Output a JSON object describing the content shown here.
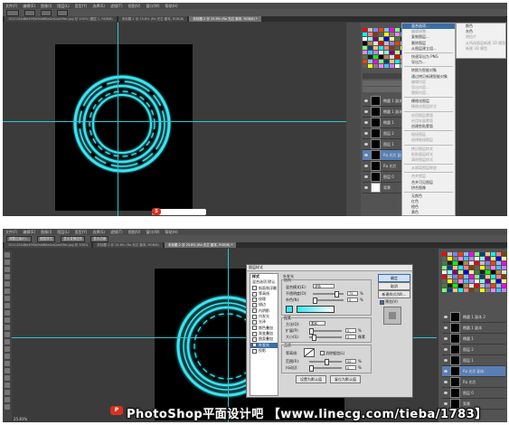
{
  "top": {
    "menubar": [
      "文件(F)",
      "编辑(E)",
      "图像(I)",
      "图层(L)",
      "类型(Y)",
      "选择(S)",
      "滤镜(T)",
      "视图(V)",
      "窗口(W)",
      "帮助(H)"
    ],
    "tabs": [
      "1511204d8e49f5b9dd68a0cb2ae0fec.jpg @ 100% (图层 1, RGB/8)",
      "未标题-1 @ 25.8% (Ra 光芯 副本, RGB/8)",
      "未标题-2 @ 25.8% (Ra 光芯 副本, RGB/8) *"
    ],
    "context_menu": [
      {
        "label": "混合选项...",
        "state": "hi"
      },
      {
        "label": "编辑调整...",
        "state": "dis"
      },
      {
        "label": "复制图层...",
        "state": "normal"
      },
      {
        "label": "删除图层",
        "state": "normal"
      },
      {
        "label": "从图层建立组...",
        "state": "normal"
      },
      {
        "sep": true
      },
      {
        "label": "快速导出为 PNG",
        "state": "normal"
      },
      {
        "label": "导出为...",
        "state": "normal"
      },
      {
        "sep": true
      },
      {
        "label": "转换为智能对象",
        "state": "normal"
      },
      {
        "label": "通过拷贝新建智能对象",
        "state": "normal"
      },
      {
        "label": "编辑内容",
        "state": "dis"
      },
      {
        "label": "导出内容...",
        "state": "dis"
      },
      {
        "label": "替换内容...",
        "state": "dis"
      },
      {
        "sep": true
      },
      {
        "label": "栅格化图层",
        "state": "normal"
      },
      {
        "label": "栅格化图层样式",
        "state": "dis"
      },
      {
        "sep": true
      },
      {
        "label": "启用图层蒙版",
        "state": "dis"
      },
      {
        "label": "启用矢量蒙版",
        "state": "dis"
      },
      {
        "label": "创建剪贴蒙版",
        "state": "normal"
      },
      {
        "sep": true
      },
      {
        "label": "链接图层",
        "state": "dis"
      },
      {
        "label": "选择链接图层",
        "state": "dis"
      },
      {
        "sep": true
      },
      {
        "label": "拷贝图层样式",
        "state": "dis"
      },
      {
        "label": "粘贴图层样式",
        "state": "dis"
      },
      {
        "label": "清除图层样式",
        "state": "dis"
      },
      {
        "sep": true
      },
      {
        "label": "从隔离图层释放",
        "state": "dis"
      },
      {
        "sep": true
      },
      {
        "label": "合并图层",
        "state": "dis"
      },
      {
        "label": "合并可见图层",
        "state": "normal"
      },
      {
        "label": "拼合图像",
        "state": "normal"
      },
      {
        "sep": true
      },
      {
        "label": "无颜色",
        "state": "normal"
      },
      {
        "label": "红色",
        "state": "normal"
      },
      {
        "label": "橙色",
        "state": "normal"
      },
      {
        "label": "黄色",
        "state": "normal"
      },
      {
        "label": "绿色",
        "state": "normal"
      }
    ],
    "submenu": [
      "颜色",
      "灰色",
      "明信片",
      "从所选图层新建 3D 模型",
      "新建 3D 模型"
    ],
    "layers": [
      {
        "name": "椭圆 1 副本 2",
        "thumb": "black"
      },
      {
        "name": "椭圆 1 副本",
        "thumb": "black"
      },
      {
        "name": "椭圆 1",
        "thumb": "black"
      },
      {
        "name": "图层 2",
        "thumb": "black"
      },
      {
        "name": "图层 1",
        "thumb": "black"
      },
      {
        "name": "Ra 光芯 副本",
        "thumb": "black",
        "selected": true
      },
      {
        "name": "Ra 光芯",
        "thumb": "black"
      },
      {
        "name": "图层 0",
        "thumb": "black"
      },
      {
        "name": "背景",
        "thumb": "white"
      }
    ]
  },
  "bottom": {
    "menubar": [
      "文件(F)",
      "编辑(E)",
      "图像(I)",
      "图层(L)",
      "类型(Y)",
      "选择(S)",
      "滤镜(T)",
      "视图(V)",
      "窗口(W)",
      "帮助(H)"
    ],
    "options": [
      "调整边缘(E)...",
      "图层样式",
      "显示变换控件",
      "显示边缘"
    ],
    "tabs": [
      "1511204d8e49f5b9dd68a0cb2ae0fec.jpg @ 100%",
      "未标题-1 @ 25.8% (Ra 光芯 副本, RGB/8)",
      "未标题-2 @ 25.8% (Ra 光芯 副本, RGB/8) *"
    ],
    "dialog": {
      "title": "图层样式",
      "style_list_header": "样式",
      "style_list": [
        {
          "label": "混合选项:默认",
          "check": false
        },
        {
          "label": "斜面和浮雕",
          "check": true
        },
        {
          "label": "等高线",
          "check": true
        },
        {
          "label": "纹理",
          "check": true
        },
        {
          "label": "描边",
          "check": true
        },
        {
          "label": "内阴影",
          "check": true
        },
        {
          "label": "内发光",
          "check": true
        },
        {
          "label": "光泽",
          "check": true
        },
        {
          "label": "颜色叠加",
          "check": true
        },
        {
          "label": "渐变叠加",
          "check": true
        },
        {
          "label": "图案叠加",
          "check": true
        },
        {
          "label": "外发光",
          "check": true,
          "selected": true
        },
        {
          "label": "投影",
          "check": true
        }
      ],
      "section_title": "外发光",
      "group_structure": "结构",
      "blend_mode_label": "混合模式(E):",
      "blend_mode_value": "滤色",
      "opacity_label": "不透明度(O):",
      "opacity_value": "75",
      "noise_label": "杂色(N):",
      "noise_value": "0",
      "group_elements": "图素",
      "method_label": "方法(Q):",
      "method_value": "柔和",
      "spread_label": "扩展(P):",
      "spread_value": "0",
      "size_label": "大小(S):",
      "size_value": "5",
      "size_unit": "像素",
      "group_quality": "品质",
      "contour_label": "等高线:",
      "antialias_label": "消除锯齿(L)",
      "range_label": "范围(R):",
      "range_value": "50",
      "jitter_label": "抖动(J):",
      "jitter_value": "0",
      "set_default": "设置为默认值",
      "reset_default": "复位为默认值",
      "ok": "确定",
      "cancel": "取消",
      "new_style": "新建样式(W)...",
      "preview": "预览(V)",
      "percent": "%"
    },
    "layers": [
      {
        "name": "椭圆 1 副本 2"
      },
      {
        "name": "椭圆 1 副本"
      },
      {
        "name": "椭圆 1"
      },
      {
        "name": "图层 2"
      },
      {
        "name": "图层 1"
      },
      {
        "name": "Ra 光芯 副本",
        "selected": true
      },
      {
        "name": "Ra 光芯"
      },
      {
        "name": "图层 0"
      },
      {
        "name": "背景"
      }
    ],
    "status": "25.81%"
  },
  "watermark": "PhotoShop平面设计吧 【www.linecg.com/tieba/1783】",
  "colors": {
    "accent": "#28c8d8",
    "ring": "#3ae4f0",
    "ui_dark": "#3b3b3b",
    "selection": "#3a6ea5"
  }
}
